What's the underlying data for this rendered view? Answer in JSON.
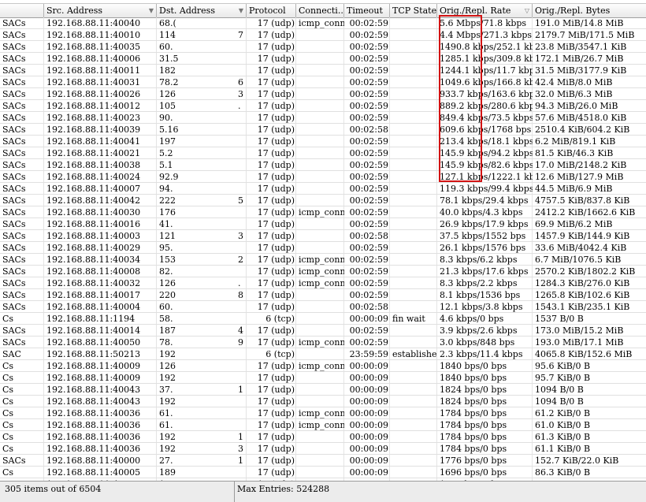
{
  "columns": [
    {
      "key": "flag",
      "label": ""
    },
    {
      "key": "src",
      "label": "Src. Address"
    },
    {
      "key": "dst",
      "label": "Dst. Address"
    },
    {
      "key": "proto",
      "label": "Protocol"
    },
    {
      "key": "conn",
      "label": "Connecti..."
    },
    {
      "key": "tout",
      "label": "Timeout"
    },
    {
      "key": "tcp",
      "label": "TCP State"
    },
    {
      "key": "rate",
      "label": "Orig./Repl. Rate"
    },
    {
      "key": "bytes",
      "label": "Orig./Repl. Bytes"
    }
  ],
  "rows": [
    [
      "SACs",
      "192.168.88.11:40040",
      "68.(",
      "",
      "17 (udp)",
      "icmp_conn",
      "00:02:59",
      "",
      "5.6 Mbps/71.8 kbps",
      "191.0 MiB/14.8 MiB"
    ],
    [
      "SACs",
      "192.168.88.11:40010",
      "114",
      "7",
      "17 (udp)",
      "",
      "00:02:59",
      "",
      "4.4 Mbps/271.3 kbps",
      "2179.7 MiB/171.5 MiB"
    ],
    [
      "SACs",
      "192.168.88.11:40035",
      "60.",
      "",
      "17 (udp)",
      "",
      "00:02:59",
      "",
      "1490.8 kbps/252.1 kbps",
      "23.8 MiB/3547.1 KiB"
    ],
    [
      "SACs",
      "192.168.88.11:40006",
      "31.5",
      "",
      "17 (udp)",
      "",
      "00:02:59",
      "",
      "1285.1 kbps/309.8 kbps",
      "172.1 MiB/26.7 MiB"
    ],
    [
      "SACs",
      "192.168.88.11:40011",
      "182",
      "",
      "17 (udp)",
      "",
      "00:02:59",
      "",
      "1244.1 kbps/11.7 kbps",
      "31.5 MiB/3177.9 KiB"
    ],
    [
      "SACs",
      "192.168.88.11:40031",
      "78.2",
      "6",
      "17 (udp)",
      "",
      "00:02:59",
      "",
      "1049.6 kbps/166.8 kbps",
      "42.4 MiB/8.0 MiB"
    ],
    [
      "SACs",
      "192.168.88.11:40026",
      "126",
      "3",
      "17 (udp)",
      "",
      "00:02:59",
      "",
      "933.7 kbps/163.6 kbps",
      "32.0 MiB/6.3 MiB"
    ],
    [
      "SACs",
      "192.168.88.11:40012",
      "105",
      ".",
      "17 (udp)",
      "",
      "00:02:59",
      "",
      "889.2 kbps/280.6 kbps",
      "94.3 MiB/26.0 MiB"
    ],
    [
      "SACs",
      "192.168.88.11:40023",
      "90.",
      "",
      "17 (udp)",
      "",
      "00:02:59",
      "",
      "849.4 kbps/73.5 kbps",
      "57.6 MiB/4518.0 KiB"
    ],
    [
      "SACs",
      "192.168.88.11:40039",
      "5.16",
      "",
      "17 (udp)",
      "",
      "00:02:58",
      "",
      "609.6 kbps/1768 bps",
      "2510.4 KiB/604.2 KiB"
    ],
    [
      "SACs",
      "192.168.88.11:40041",
      "197",
      "",
      "17 (udp)",
      "",
      "00:02:59",
      "",
      "213.4 kbps/18.1 kbps",
      "6.2 MiB/819.1 KiB"
    ],
    [
      "SACs",
      "192.168.88.11:40021",
      "5.2",
      "",
      "17 (udp)",
      "",
      "00:02:59",
      "",
      "145.9 kbps/94.2 kbps",
      "81.5 KiB/46.3 KiB"
    ],
    [
      "SACs",
      "192.168.88.11:40038",
      "5.1",
      "",
      "17 (udp)",
      "",
      "00:02:59",
      "",
      "145.9 kbps/82.6 kbps",
      "17.0 MiB/2148.2 KiB"
    ],
    [
      "SACs",
      "192.168.88.11:40024",
      "92.9",
      "",
      "17 (udp)",
      "",
      "00:02:59",
      "",
      "127.1 kbps/1222.1 kbps",
      "12.6 MiB/127.9 MiB"
    ],
    [
      "SACs",
      "192.168.88.11:40007",
      "94.",
      "",
      "17 (udp)",
      "",
      "00:02:59",
      "",
      "119.3 kbps/99.4 kbps",
      "44.5 MiB/6.9 MiB"
    ],
    [
      "SACs",
      "192.168.88.11:40042",
      "222",
      "5",
      "17 (udp)",
      "",
      "00:02:59",
      "",
      "78.1 kbps/29.4 kbps",
      "4757.5 KiB/837.8 KiB"
    ],
    [
      "SACs",
      "192.168.88.11:40030",
      "176",
      "",
      "17 (udp)",
      "icmp_conn",
      "00:02:59",
      "",
      "40.0 kbps/4.3 kbps",
      "2412.2 KiB/1662.6 KiB"
    ],
    [
      "SACs",
      "192.168.88.11:40016",
      "41.",
      "",
      "17 (udp)",
      "",
      "00:02:59",
      "",
      "26.9 kbps/17.9 kbps",
      "69.9 MiB/6.2 MiB"
    ],
    [
      "SACs",
      "192.168.88.11:40003",
      "121",
      "3",
      "17 (udp)",
      "",
      "00:02:58",
      "",
      "37.5 kbps/1552 bps",
      "1457.9 KiB/144.9 KiB"
    ],
    [
      "SACs",
      "192.168.88.11:40029",
      "95.",
      "",
      "17 (udp)",
      "",
      "00:02:59",
      "",
      "26.1 kbps/1576 bps",
      "33.6 MiB/4042.4 KiB"
    ],
    [
      "SACs",
      "192.168.88.11:40034",
      "153",
      "2",
      "17 (udp)",
      "icmp_conn",
      "00:02:59",
      "",
      "8.3 kbps/6.2 kbps",
      "6.7 MiB/1076.5 KiB"
    ],
    [
      "SACs",
      "192.168.88.11:40008",
      "82.",
      "",
      "17 (udp)",
      "icmp_conn",
      "00:02:59",
      "",
      "21.3 kbps/17.6 kbps",
      "2570.2 KiB/1802.2 KiB"
    ],
    [
      "SACs",
      "192.168.88.11:40032",
      "126",
      ".",
      "17 (udp)",
      "icmp_conn",
      "00:02:59",
      "",
      "8.3 kbps/2.2 kbps",
      "1284.3 KiB/276.0 KiB"
    ],
    [
      "SACs",
      "192.168.88.11:40017",
      "220",
      "8",
      "17 (udp)",
      "",
      "00:02:59",
      "",
      "8.1 kbps/1536 bps",
      "1265.8 KiB/102.6 KiB"
    ],
    [
      "SACs",
      "192.168.88.11:40004",
      "60.",
      "",
      "17 (udp)",
      "",
      "00:02:58",
      "",
      "12.1 kbps/3.8 kbps",
      "1543.1 KiB/235.1 KiB"
    ],
    [
      "Cs",
      "192.168.88.11:1194",
      "58.",
      "",
      "6 (tcp)",
      "",
      "00:00:09",
      "fin wait",
      "4.6 kbps/0 bps",
      "1537 B/0 B"
    ],
    [
      "SACs",
      "192.168.88.11:40014",
      "187",
      "4",
      "17 (udp)",
      "",
      "00:02:59",
      "",
      "3.9 kbps/2.6 kbps",
      "173.0 MiB/15.2 MiB"
    ],
    [
      "SACs",
      "192.168.88.11:40050",
      "78.",
      "9",
      "17 (udp)",
      "icmp_conn",
      "00:02:59",
      "",
      "3.0 kbps/848 bps",
      "193.0 MiB/17.1 MiB"
    ],
    [
      "SAC",
      "192.168.88.11:50213",
      "192",
      "",
      "6 (tcp)",
      "",
      "23:59:59",
      "established",
      "2.3 kbps/11.4 kbps",
      "4065.8 KiB/152.6 MiB"
    ],
    [
      "Cs",
      "192.168.88.11:40009",
      "126",
      "",
      "17 (udp)",
      "icmp_conn",
      "00:00:09",
      "",
      "1840 bps/0 bps",
      "95.6 KiB/0 B"
    ],
    [
      "Cs",
      "192.168.88.11:40009",
      "192",
      "",
      "17 (udp)",
      "",
      "00:00:09",
      "",
      "1840 bps/0 bps",
      "95.7 KiB/0 B"
    ],
    [
      "Cs",
      "192.168.88.11:40043",
      "37.",
      "1",
      "17 (udp)",
      "",
      "00:00:09",
      "",
      "1824 bps/0 bps",
      "1094 B/0 B"
    ],
    [
      "Cs",
      "192.168.88.11:40043",
      "192",
      "",
      "17 (udp)",
      "",
      "00:00:09",
      "",
      "1824 bps/0 bps",
      "1094 B/0 B"
    ],
    [
      "Cs",
      "192.168.88.11:40036",
      "61.",
      "",
      "17 (udp)",
      "icmp_conn",
      "00:00:09",
      "",
      "1784 bps/0 bps",
      "61.2 KiB/0 B"
    ],
    [
      "Cs",
      "192.168.88.11:40036",
      "61.",
      "",
      "17 (udp)",
      "icmp_conn",
      "00:00:09",
      "",
      "1784 bps/0 bps",
      "61.0 KiB/0 B"
    ],
    [
      "Cs",
      "192.168.88.11:40036",
      "192",
      "1",
      "17 (udp)",
      "",
      "00:00:09",
      "",
      "1784 bps/0 bps",
      "61.3 KiB/0 B"
    ],
    [
      "Cs",
      "192.168.88.11:40036",
      "192",
      "3",
      "17 (udp)",
      "",
      "00:00:09",
      "",
      "1784 bps/0 bps",
      "61.1 KiB/0 B"
    ],
    [
      "SACs",
      "192.168.88.11:40000",
      "27.",
      "1",
      "17 (udp)",
      "",
      "00:00:09",
      "",
      "1776 bps/0 bps",
      "152.7 KiB/22.0 KiB"
    ],
    [
      "Cs",
      "192.168.88.11:40005",
      "189",
      "",
      "17 (udp)",
      "",
      "00:00:09",
      "",
      "1696 bps/0 bps",
      "86.3 KiB/0 B"
    ],
    [
      "Cs",
      "192.168.88.11:40005",
      "192",
      "",
      "17 (udp)",
      "",
      "00:00:09",
      "",
      "1696 bps/0 bps",
      "86.3 KiB/0 B"
    ]
  ],
  "status": {
    "items": "305 items out of 6504",
    "max_entries": "Max Entries: 524288"
  },
  "colors": {
    "highlight": "#d21414"
  }
}
